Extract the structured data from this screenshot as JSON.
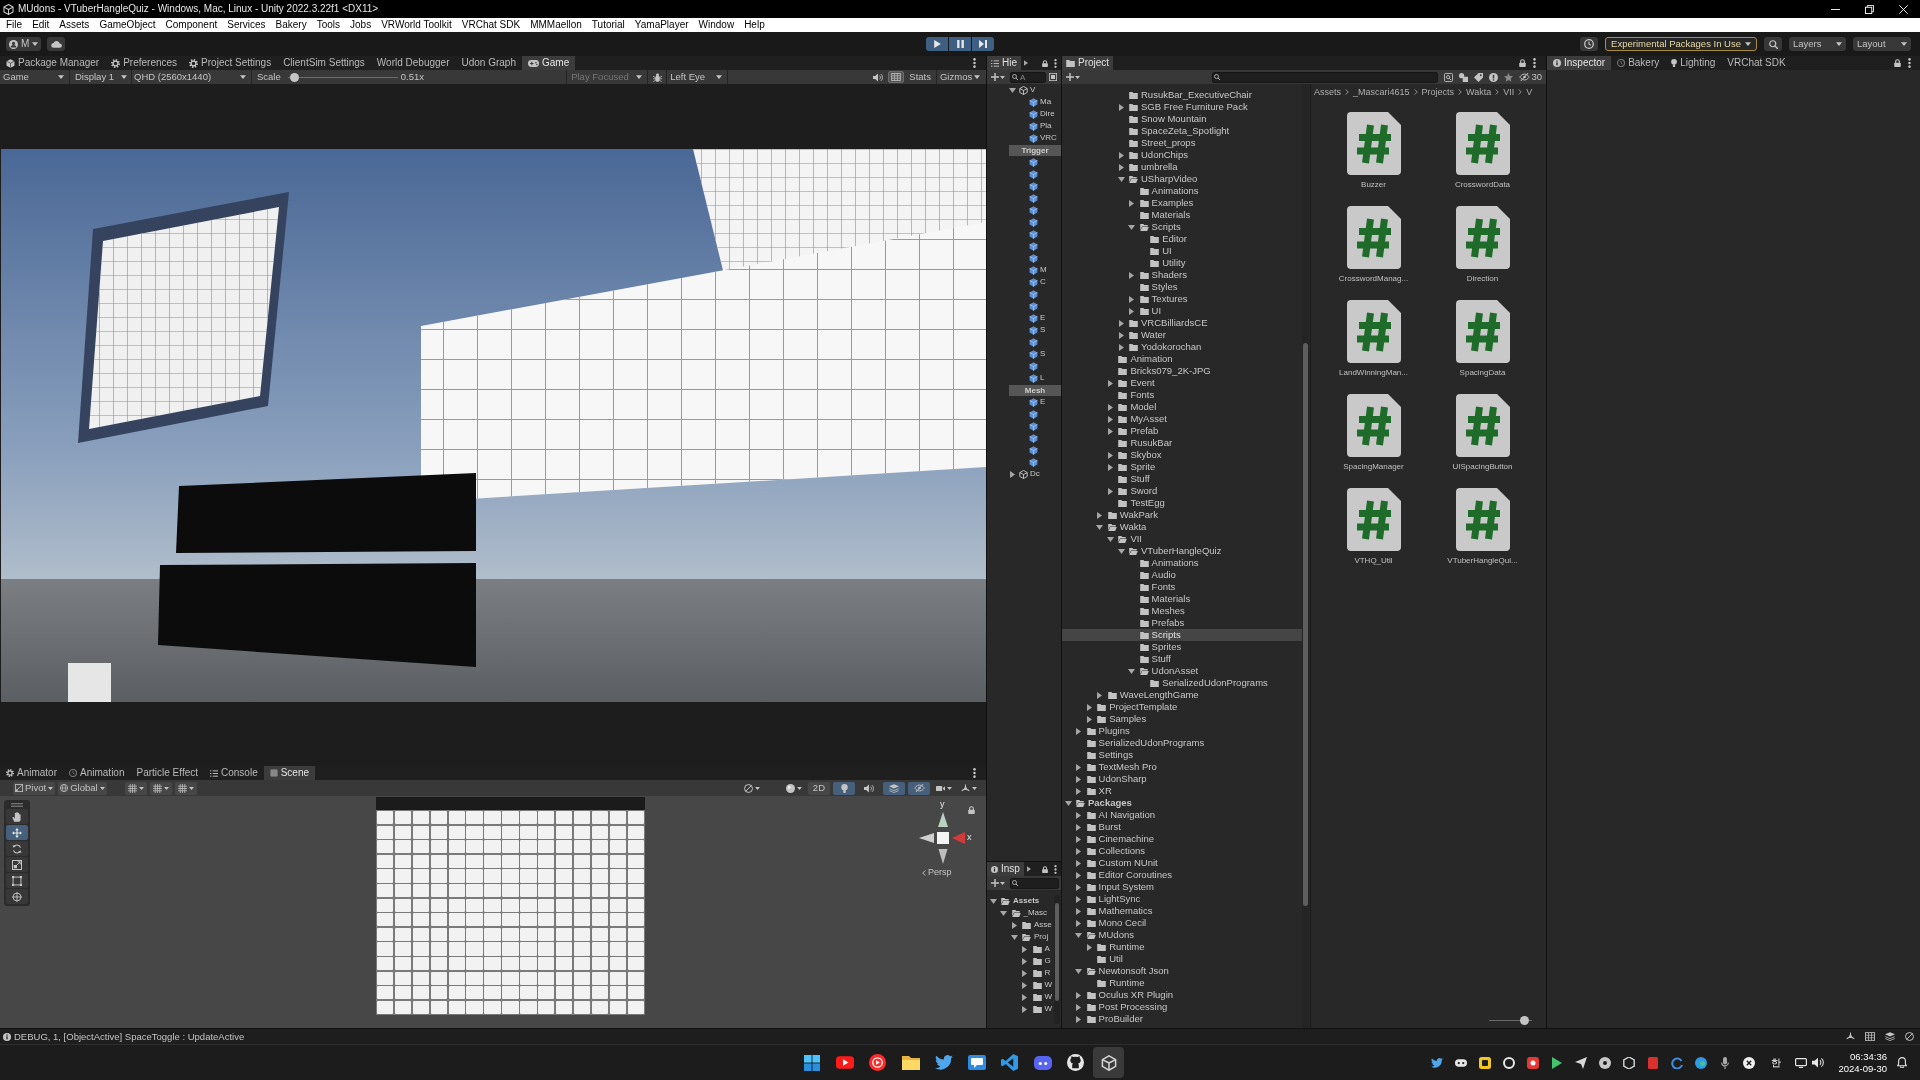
{
  "window": {
    "title": "MUdons - VTuberHangleQuiz - Windows, Mac, Linux - Unity 2022.3.22f1 <DX11>"
  },
  "menu": [
    "File",
    "Edit",
    "Assets",
    "GameObject",
    "Component",
    "Services",
    "Bakery",
    "Tools",
    "Jobs",
    "VRWorld Toolkit",
    "VRChat SDK",
    "MMMaellon",
    "Tutorial",
    "YamaPlayer",
    "Window",
    "Help"
  ],
  "toolbar": {
    "account": "M",
    "playing": true,
    "notice": "Experimental Packages In Use",
    "layers": "Layers",
    "layout": "Layout"
  },
  "game": {
    "tabs": [
      {
        "label": "Package Manager",
        "selected": false
      },
      {
        "label": "Preferences",
        "selected": false
      },
      {
        "label": "Project Settings",
        "selected": false
      },
      {
        "label": "ClientSim Settings",
        "selected": false
      },
      {
        "label": "World Debugger",
        "selected": false
      },
      {
        "label": "Udon Graph",
        "selected": false
      },
      {
        "label": "Game",
        "selected": true
      }
    ],
    "view": "Game",
    "display": "Display 1",
    "resolution": "QHD (2560x1440)",
    "scale_label": "Scale",
    "scale": {
      "level": 0.02
    },
    "scale_value": "0.51x",
    "play_mode": {
      "label": "Play Focused",
      "disabled": true
    },
    "eye": "Left Eye",
    "grid_toggle": {
      "on": true
    },
    "stats": "Stats",
    "gizmos": "Gizmos"
  },
  "scene": {
    "tabs": [
      {
        "label": "Animator",
        "selected": false
      },
      {
        "label": "Animation",
        "selected": false
      },
      {
        "label": "Particle Effect",
        "selected": false
      },
      {
        "label": "Console",
        "selected": false
      },
      {
        "label": "Scene",
        "selected": true
      }
    ],
    "pivot": "Pivot",
    "space": "Global",
    "mode_2d": {
      "label": "2D",
      "on": false
    },
    "toggles": [
      {
        "on": true
      },
      {
        "on": false
      },
      {
        "on": true
      },
      {
        "on": true
      }
    ],
    "tools": [
      {
        "selected": false
      },
      {
        "selected": true
      },
      {
        "selected": false
      },
      {
        "selected": false
      },
      {
        "selected": false
      },
      {
        "selected": false
      }
    ],
    "gizmo": {
      "y_label": "y",
      "x_label": "x",
      "projection": "Persp"
    }
  },
  "hierarchy": {
    "tab": "Hie",
    "search_placeholder": "A",
    "rows": [
      {
        "kind": "scene",
        "label": "V",
        "expanded": true,
        "selected": false,
        "children": [
          {
            "kind": "object",
            "label": "Ma",
            "selected": false
          },
          {
            "kind": "object",
            "label": "Dire",
            "selected": false
          },
          {
            "kind": "object",
            "label": "Pla",
            "selected": false
          },
          {
            "kind": "object",
            "label": "VRC",
            "selected": false
          },
          {
            "kind": "header",
            "label": "Trigger",
            "selected": false
          },
          {
            "kind": "object",
            "selected": false
          },
          {
            "kind": "object",
            "selected": false
          },
          {
            "kind": "object",
            "selected": false
          },
          {
            "kind": "object",
            "selected": false
          },
          {
            "kind": "object",
            "selected": false
          },
          {
            "kind": "object",
            "selected": false
          },
          {
            "kind": "object",
            "selected": false
          },
          {
            "kind": "object",
            "selected": false
          },
          {
            "kind": "object",
            "selected": false
          },
          {
            "kind": "object",
            "label": "M",
            "selected": false
          },
          {
            "kind": "object",
            "label": "C",
            "selected": false
          },
          {
            "kind": "object",
            "selected": false
          },
          {
            "kind": "object",
            "selected": false
          },
          {
            "kind": "object",
            "label": "E",
            "selected": false
          },
          {
            "kind": "object",
            "label": "S",
            "selected": false
          },
          {
            "kind": "object",
            "selected": false
          },
          {
            "kind": "object",
            "label": "S",
            "selected": false
          },
          {
            "kind": "object",
            "selected": false
          },
          {
            "kind": "object",
            "label": "L",
            "selected": false
          },
          {
            "kind": "header",
            "label": "Mesh",
            "selected": false
          },
          {
            "kind": "object",
            "label": "E",
            "selected": false
          },
          {
            "kind": "object",
            "selected": false
          },
          {
            "kind": "object",
            "selected": false
          },
          {
            "kind": "object",
            "selected": false
          },
          {
            "kind": "object",
            "selected": false
          },
          {
            "kind": "object",
            "selected": false
          }
        ]
      },
      {
        "kind": "scene",
        "label": "Dc",
        "expanded": false,
        "selected": false
      }
    ]
  },
  "mini_panel": {
    "tab": "Insp",
    "tree": [
      {
        "label": "Assets",
        "expanded": true,
        "selected": false,
        "children": [
          {
            "label": "_Masc",
            "expanded": true,
            "selected": false,
            "children": [
              {
                "label": "Asse",
                "expanded": false,
                "selected": false
              },
              {
                "label": "Proj",
                "expanded": true,
                "selected": false,
                "children": [
                  {
                    "label": "A",
                    "expanded": false,
                    "selected": false
                  },
                  {
                    "label": "G",
                    "expanded": false,
                    "selected": false
                  },
                  {
                    "label": "R",
                    "expanded": false,
                    "selected": false
                  },
                  {
                    "label": "W",
                    "expanded": false,
                    "selected": false
                  },
                  {
                    "label": "W",
                    "expanded": false,
                    "selected": false
                  },
                  {
                    "label": "W",
                    "expanded": false,
                    "selected": false
                  }
                ]
              }
            ]
          }
        ]
      }
    ]
  },
  "project": {
    "tab": "Project",
    "hidden_count": "30",
    "tree": [
      {
        "children": [
          {
            "children": [
              {
                "children": [
                  {
                    "children": [
                      {
                        "children": [
                          {
                            "label": "RusukBar_ExecutiveChair",
                            "selected": false
                          },
                          {
                            "label": "SGB Free Furniture Pack",
                            "expanded": false,
                            "selected": false
                          },
                          {
                            "label": "Snow Mountain",
                            "selected": false
                          },
                          {
                            "label": "SpaceZeta_Spotlight",
                            "selected": false
                          },
                          {
                            "label": "Street_props",
                            "selected": false
                          },
                          {
                            "label": "UdonChips",
                            "expanded": false,
                            "selected": false
                          },
                          {
                            "label": "umbrella",
                            "expanded": false,
                            "selected": false
                          },
                          {
                            "label": "USharpVideo",
                            "expanded": true,
                            "selected": false,
                            "children": [
                              {
                                "label": "Animations",
                                "selected": false
                              },
                              {
                                "label": "Examples",
                                "expanded": false,
                                "selected": false
                              },
                              {
                                "label": "Materials",
                                "selected": false
                              },
                              {
                                "label": "Scripts",
                                "expanded": true,
                                "selected": false,
                                "children": [
                                  {
                                    "label": "Editor",
                                    "selected": false
                                  },
                                  {
                                    "label": "UI",
                                    "selected": false
                                  },
                                  {
                                    "label": "Utility",
                                    "selected": false
                                  }
                                ]
                              },
                              {
                                "label": "Shaders",
                                "expanded": false,
                                "selected": false
                              },
                              {
                                "label": "Styles",
                                "selected": false
                              },
                              {
                                "label": "Textures",
                                "expanded": false,
                                "selected": false
                              },
                              {
                                "label": "UI",
                                "expanded": false,
                                "selected": false
                              }
                            ]
                          },
                          {
                            "label": "VRCBilliardsCE",
                            "expanded": false,
                            "selected": false
                          },
                          {
                            "label": "Water",
                            "expanded": false,
                            "selected": false
                          },
                          {
                            "label": "Yodokorochan",
                            "expanded": false,
                            "selected": false
                          }
                        ]
                      },
                      {
                        "label": "Animation",
                        "selected": false
                      },
                      {
                        "label": "Bricks079_2K-JPG",
                        "selected": false
                      },
                      {
                        "label": "Event",
                        "expanded": false,
                        "selected": false
                      },
                      {
                        "label": "Fonts",
                        "selected": false
                      },
                      {
                        "label": "Model",
                        "expanded": false,
                        "selected": false
                      },
                      {
                        "label": "MyAsset",
                        "expanded": false,
                        "selected": false
                      },
                      {
                        "label": "Prefab",
                        "expanded": false,
                        "selected": false
                      },
                      {
                        "label": "RusukBar",
                        "selected": false
                      },
                      {
                        "label": "Skybox",
                        "expanded": false,
                        "selected": false
                      },
                      {
                        "label": "Sprite",
                        "expanded": false,
                        "selected": false
                      },
                      {
                        "label": "Stuff",
                        "selected": false
                      },
                      {
                        "label": "Sword",
                        "expanded": false,
                        "selected": false
                      },
                      {
                        "label": "TestEgg",
                        "selected": false
                      }
                    ]
                  },
                  {
                    "label": "WakPark",
                    "expanded": false,
                    "selected": false
                  },
                  {
                    "label": "Wakta",
                    "expanded": true,
                    "selected": false,
                    "children": [
                      {
                        "label": "VII",
                        "expanded": true,
                        "selected": false,
                        "children": [
                          {
                            "label": "VTuberHangleQuiz",
                            "expanded": true,
                            "selected": false,
                            "children": [
                              {
                                "label": "Animations",
                                "selected": false
                              },
                              {
                                "label": "Audio",
                                "selected": false
                              },
                              {
                                "label": "Fonts",
                                "selected": false
                              },
                              {
                                "label": "Materials",
                                "selected": false
                              },
                              {
                                "label": "Meshes",
                                "selected": false
                              },
                              {
                                "label": "Prefabs",
                                "selected": false
                              },
                              {
                                "label": "Scripts",
                                "selected": true
                              },
                              {
                                "label": "Sprites",
                                "selected": false
                              },
                              {
                                "label": "Stuff",
                                "selected": false
                              },
                              {
                                "label": "UdonAsset",
                                "expanded": true,
                                "selected": false,
                                "children": [
                                  {
                                    "label": "SerializedUdonPrograms",
                                    "selected": false
                                  }
                                ]
                              }
                            ]
                          }
                        ]
                      }
                    ]
                  },
                  {
                    "label": "WaveLengthGame",
                    "expanded": false,
                    "selected": false
                  }
                ]
              },
              {
                "label": "ProjectTemplate",
                "expanded": false,
                "selected": false
              },
              {
                "label": "Samples",
                "expanded": false,
                "selected": false
              }
            ]
          },
          {
            "label": "Plugins",
            "expanded": false,
            "selected": false
          },
          {
            "label": "SerializedUdonPrograms",
            "selected": false
          },
          {
            "label": "Settings",
            "selected": false
          },
          {
            "label": "TextMesh Pro",
            "expanded": false,
            "selected": false
          },
          {
            "label": "UdonSharp",
            "expanded": false,
            "selected": false
          },
          {
            "label": "XR",
            "expanded": false,
            "selected": false
          }
        ]
      },
      {
        "label": "Packages",
        "expanded": true,
        "selected": false,
        "children": [
          {
            "label": "AI Navigation",
            "expanded": false,
            "selected": false
          },
          {
            "label": "Burst",
            "expanded": false,
            "selected": false
          },
          {
            "label": "Cinemachine",
            "expanded": false,
            "selected": false
          },
          {
            "label": "Collections",
            "expanded": false,
            "selected": false
          },
          {
            "label": "Custom NUnit",
            "expanded": false,
            "selected": false
          },
          {
            "label": "Editor Coroutines",
            "expanded": false,
            "selected": false
          },
          {
            "label": "Input System",
            "expanded": false,
            "selected": false
          },
          {
            "label": "LightSync",
            "expanded": false,
            "selected": false
          },
          {
            "label": "Mathematics",
            "expanded": false,
            "selected": false
          },
          {
            "label": "Mono Cecil",
            "expanded": false,
            "selected": false
          },
          {
            "label": "MUdons",
            "expanded": true,
            "selected": false,
            "children": [
              {
                "label": "Runtime",
                "expanded": false,
                "selected": false
              },
              {
                "label": "Util",
                "selected": false
              }
            ]
          },
          {
            "label": "Newtonsoft Json",
            "expanded": true,
            "selected": false,
            "children": [
              {
                "label": "Runtime",
                "selected": false
              }
            ]
          },
          {
            "label": "Oculus XR Plugin",
            "expanded": false,
            "selected": false
          },
          {
            "label": "Post Processing",
            "expanded": false,
            "selected": false
          },
          {
            "label": "ProBuilder",
            "expanded": false,
            "selected": false
          }
        ]
      }
    ],
    "breadcrumb": [
      "Assets",
      "_Mascari4615",
      "Projects",
      "Wakta",
      "VII",
      "V"
    ],
    "assets": [
      {
        "label": "Buzzer",
        "selected": false
      },
      {
        "label": "CrosswordData",
        "selected": false
      },
      {
        "label": "CrosswordManag...",
        "selected": false
      },
      {
        "label": "Direction",
        "selected": false
      },
      {
        "label": "LandWinningMan...",
        "selected": false
      },
      {
        "label": "SpacingData",
        "selected": false
      },
      {
        "label": "SpacingManager",
        "selected": false
      },
      {
        "label": "UISpacingButton",
        "selected": false
      },
      {
        "label": "VTHQ_Util",
        "selected": false
      },
      {
        "label": "VTuberHangleQui...",
        "selected": false
      }
    ],
    "icon_size": {
      "level": 0.9
    }
  },
  "inspector": {
    "tabs": [
      {
        "label": "Inspector",
        "selected": true
      },
      {
        "label": "Bakery",
        "selected": false
      },
      {
        "label": "Lighting",
        "selected": false
      },
      {
        "label": "VRChat SDK",
        "selected": false
      }
    ]
  },
  "status_bar": {
    "message": "DEBUG, 1, [ObjectActive] SpaceToggle : UpdateActive"
  },
  "taskbar": {
    "apps": [
      {
        "selected": false
      },
      {
        "selected": false
      },
      {
        "selected": false
      },
      {
        "selected": false
      },
      {
        "selected": false
      },
      {
        "selected": false
      },
      {
        "selected": false
      },
      {
        "selected": false
      },
      {
        "selected": false
      },
      {
        "selected": true
      }
    ],
    "input_method": "한",
    "time": "06:34:36",
    "date": "2024-09-30"
  }
}
